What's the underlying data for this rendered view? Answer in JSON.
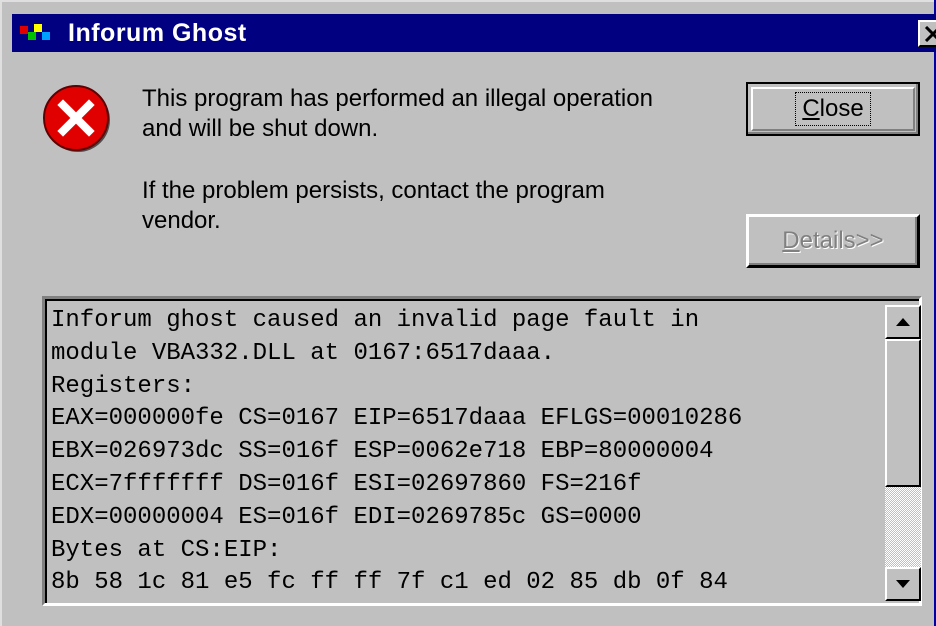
{
  "window": {
    "title": "Inforum Ghost",
    "close_glyph": "X"
  },
  "message": {
    "line1": "This program has performed an illegal operation",
    "line2": "and will be shut down.",
    "line3": "If the problem persists, contact the program",
    "line4": "vendor."
  },
  "buttons": {
    "close_label_underlined": "C",
    "close_label_rest": "lose",
    "details_label_underlined": "D",
    "details_label_rest": "etails>>"
  },
  "details": {
    "lines": [
      "Inforum ghost caused an invalid page fault in",
      "module VBA332.DLL at 0167:6517daaa.",
      "Registers:",
      "EAX=000000fe CS=0167 EIP=6517daaa EFLGS=00010286",
      "EBX=026973dc SS=016f ESP=0062e718 EBP=80000004",
      "ECX=7fffffff DS=016f ESI=02697860 FS=216f",
      "EDX=00000004 ES=016f EDI=0269785c GS=0000",
      "Bytes at CS:EIP:",
      "8b 58 1c 81 e5 fc ff ff 7f c1 ed 02 85 db 0f 84"
    ],
    "scroll_position": 0.0
  },
  "icons": {
    "error": "error-icon",
    "app": "app-icon",
    "scroll_up": "scroll-up-arrow-icon",
    "scroll_down": "scroll-down-arrow-icon"
  },
  "colors": {
    "titlebar": "#000080",
    "face": "#c0c0c0",
    "error_red": "#e00000"
  }
}
